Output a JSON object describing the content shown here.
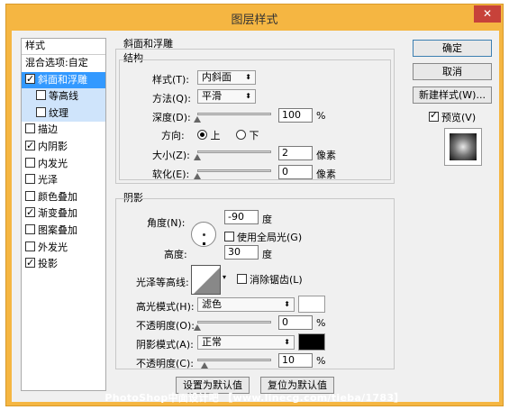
{
  "window": {
    "title": "图层样式",
    "close": "✕"
  },
  "sidebar": {
    "header": "样式",
    "blend_options": "混合选项:自定",
    "items": [
      {
        "label": "斜面和浮雕",
        "checked": true
      },
      {
        "label": "等高线",
        "checked": false
      },
      {
        "label": "纹理",
        "checked": false
      },
      {
        "label": "描边",
        "checked": false
      },
      {
        "label": "内阴影",
        "checked": true
      },
      {
        "label": "内发光",
        "checked": false
      },
      {
        "label": "光泽",
        "checked": false
      },
      {
        "label": "颜色叠加",
        "checked": false
      },
      {
        "label": "渐变叠加",
        "checked": true
      },
      {
        "label": "图案叠加",
        "checked": false
      },
      {
        "label": "外发光",
        "checked": false
      },
      {
        "label": "投影",
        "checked": true
      }
    ]
  },
  "bevel": {
    "group_title": "斜面和浮雕",
    "structure_title": "结构",
    "style_label": "样式(T):",
    "style_value": "内斜面",
    "technique_label": "方法(Q):",
    "technique_value": "平滑",
    "depth_label": "深度(D):",
    "depth_value": "100",
    "depth_unit": "%",
    "direction_label": "方向:",
    "dir_up": "上",
    "dir_down": "下",
    "size_label": "大小(Z):",
    "size_value": "2",
    "size_unit": "像素",
    "soften_label": "软化(E):",
    "soften_value": "0",
    "soften_unit": "像素"
  },
  "shading": {
    "title": "阴影",
    "angle_label": "角度(N):",
    "angle_value": "-90",
    "angle_unit": "度",
    "global_light_label": "使用全局光(G)",
    "altitude_label": "高度:",
    "altitude_value": "30",
    "altitude_unit": "度",
    "gloss_label": "光泽等高线:",
    "anti_alias_label": "消除锯齿(L)",
    "highlight_mode_label": "高光模式(H):",
    "highlight_mode_value": "滤色",
    "highlight_color": "#ffffff",
    "highlight_opacity_label": "不透明度(O):",
    "highlight_opacity_value": "0",
    "highlight_opacity_unit": "%",
    "shadow_mode_label": "阴影模式(A):",
    "shadow_mode_value": "正常",
    "shadow_color": "#000000",
    "shadow_opacity_label": "不透明度(C):",
    "shadow_opacity_value": "10",
    "shadow_opacity_unit": "%"
  },
  "footer": {
    "make_default": "设置为默认值",
    "reset_default": "复位为默认值",
    "watermark": "PhotoShop中面设计吧 【www.linecg.com/tieba/1783】"
  },
  "actions": {
    "ok": "确定",
    "cancel": "取消",
    "new_style": "新建样式(W)...",
    "preview": "预览(V)"
  },
  "levels": {
    "depth": 0.0,
    "size": 0.0,
    "soften": 0.0,
    "highlight_opacity": 0.0,
    "shadow_opacity": 0.1
  }
}
